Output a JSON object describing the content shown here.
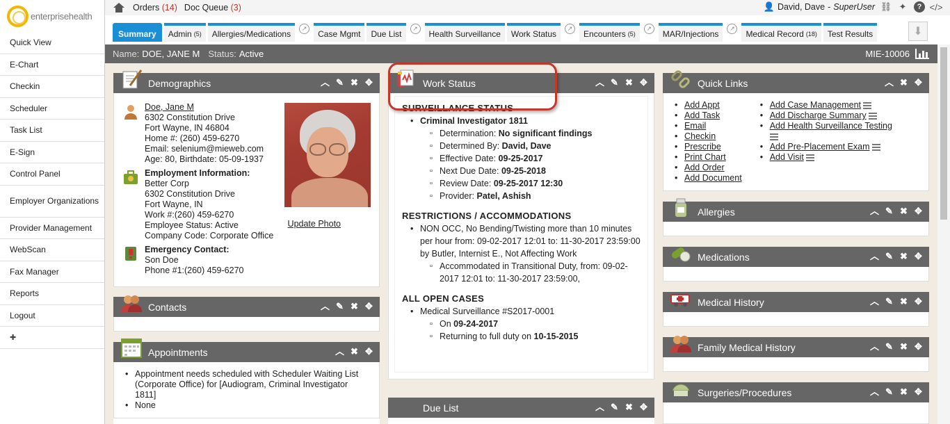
{
  "logo": {
    "text": "enterprisehealth"
  },
  "sidebar": {
    "items": [
      "Quick View",
      "E-Chart",
      "Checkin",
      "Scheduler",
      "Task List",
      "E-Sign",
      "Control Panel",
      "Employer Organizations",
      "Provider Management",
      "WebScan",
      "Fax Manager",
      "Reports",
      "Logout"
    ]
  },
  "topbar": {
    "orders_label": "Orders",
    "orders_count": "(14)",
    "docqueue_label": "Doc Queue",
    "docqueue_count": "(3)",
    "user_name": "David, Dave",
    "user_role": "SuperUser"
  },
  "tabs": [
    {
      "label": "Summary"
    },
    {
      "label": "Admin",
      "count": "(5)"
    },
    {
      "label": "Allergies/Medications"
    },
    {
      "label": "Case Mgmt"
    },
    {
      "label": "Due List"
    },
    {
      "label": "Health Surveillance"
    },
    {
      "label": "Work Status"
    },
    {
      "label": "Encounters",
      "count": "(5)"
    },
    {
      "label": "MAR/Injections"
    },
    {
      "label": "Medical Record",
      "count": "(18)"
    },
    {
      "label": "Test Results"
    }
  ],
  "patient": {
    "name_label": "Name:",
    "name": "DOE, JANE M",
    "status_label": "Status:",
    "status": "Active",
    "mrn": "MIE-10006"
  },
  "demographics": {
    "title": "Demographics",
    "name": "Doe, Jane M",
    "address1": "6302 Constitution Drive",
    "address2": "Fort Wayne, IN 46804",
    "home": "Home #: (260) 459-6270",
    "email": "Email: selenium@mieweb.com",
    "age": "Age: 80, Birthdate: 05-09-1937",
    "emp_title": "Employment Information:",
    "emp_company": "Better Corp",
    "emp_addr1": "6302 Constitution Drive",
    "emp_addr2": "Fort Wayne, IN",
    "emp_work": "Work #:(260) 459-6270",
    "emp_status": "Employee Status: Active",
    "emp_code": "Company Code: Corporate Office",
    "ec_title": "Emergency Contact:",
    "ec_name": "Son Doe",
    "ec_phone": "Phone #1:(260) 459-6270",
    "update_photo": "Update Photo"
  },
  "contacts": {
    "title": "Contacts"
  },
  "appointments": {
    "title": "Appointments",
    "item1": "Appointment needs scheduled with Scheduler Waiting List (Corporate Office) for [Audiogram, Criminal Investigator 1811]",
    "item2": "None"
  },
  "work_status": {
    "title": "Work Status",
    "surv_heading": "SURVEILLANCE STATUS",
    "position": "Criminal Investigator 1811",
    "determination_label": "Determination:",
    "determination": "No significant findings",
    "determined_by_label": "Determined By:",
    "determined_by": "David, Dave",
    "effective_label": "Effective Date:",
    "effective": "09-25-2017",
    "next_due_label": "Next Due Date:",
    "next_due": "09-25-2018",
    "review_label": "Review Date:",
    "review": "09-25-2017 12:30",
    "provider_label": "Provider:",
    "provider": "Patel, Ashish",
    "restr_heading": "RESTRICTIONS / ACCOMMODATIONS",
    "restr_item": "NON OCC, No Bending/Twisting more than 10 minutes per hour from: 09-02-2017 12:01 to: 11-30-2017 23:59:00 by Butler, Internist E., Not Affecting Work",
    "restr_sub": "Accommodated in Transitional Duty, from: 09-02-2017 12:01 to: 11-30-2017 23:59:00,",
    "cases_heading": "ALL OPEN CASES",
    "case": "Medical Surveillance #S2017-0001",
    "on_label": "On",
    "on_date": "09-24-2017",
    "return_label": "Returning to full duty on",
    "return_date": "10-15-2015"
  },
  "due_list": {
    "title": "Due List"
  },
  "quick_links": {
    "title": "Quick Links",
    "col1": [
      "Add Appt",
      "Add Task",
      "Email",
      "Checkin",
      "Prescribe",
      "Print Chart",
      "Add Order",
      "Add Document"
    ],
    "col2": [
      "Add Case Management",
      "Add Discharge Summary",
      "Add Health Surveillance Testing",
      "Add Pre-Placement Exam",
      "Add Visit"
    ]
  },
  "allergies": {
    "title": "Allergies"
  },
  "medications": {
    "title": "Medications"
  },
  "medical_history": {
    "title": "Medical History"
  },
  "family_history": {
    "title": "Family Medical History"
  },
  "surgeries": {
    "title": "Surgeries/Procedures"
  },
  "colors": {
    "tab_blue": "#1a8fd6",
    "header_gray": "#666666",
    "background": "#f1ebe1",
    "count_red": "#c0392b"
  }
}
